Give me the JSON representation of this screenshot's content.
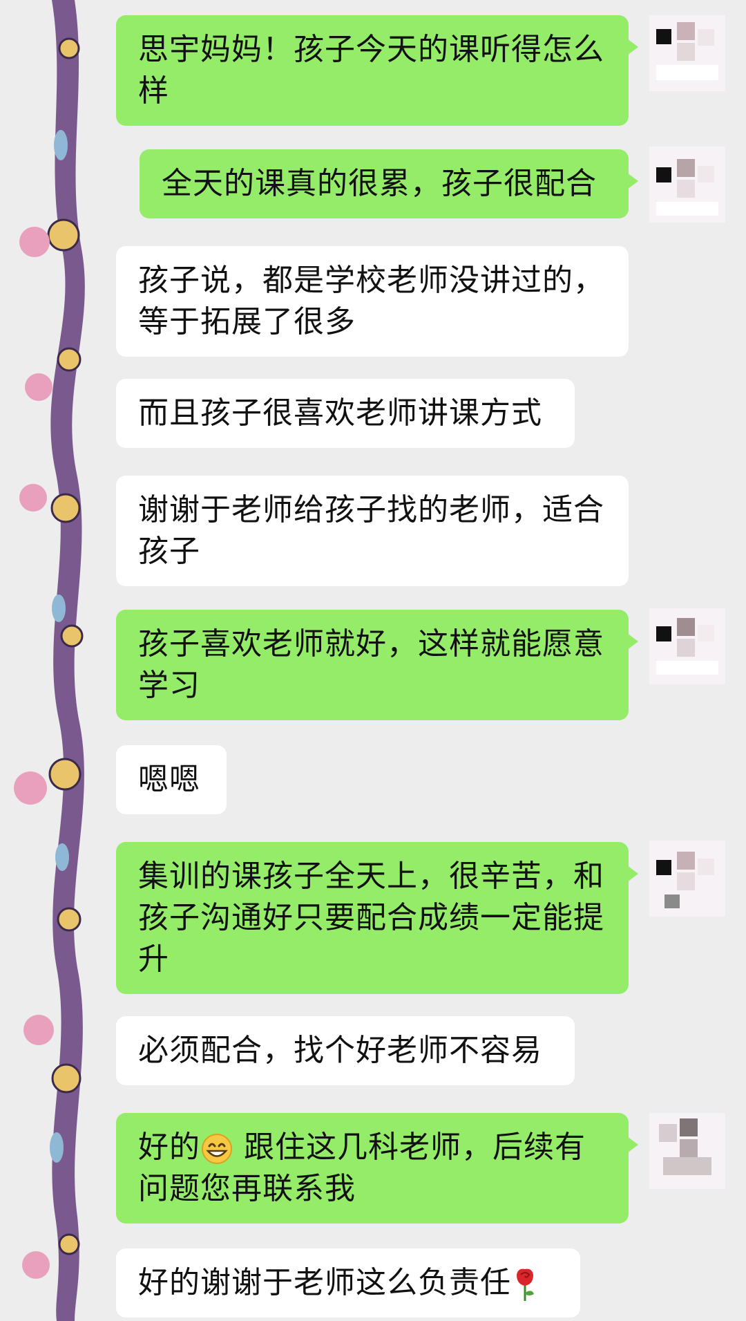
{
  "messages": [
    {
      "side": "out",
      "text": "思宇妈妈！孩子今天的课听得怎么样"
    },
    {
      "side": "out",
      "text": "全天的课真的很累，孩子很配合"
    },
    {
      "side": "in",
      "text": "孩子说，都是学校老师没讲过的，等于拓展了很多"
    },
    {
      "side": "in",
      "text": "而且孩子很喜欢老师讲课方式"
    },
    {
      "side": "in",
      "text": "谢谢于老师给孩子找的老师，适合孩子"
    },
    {
      "side": "out",
      "text": "孩子喜欢老师就好，这样就能愿意学习"
    },
    {
      "side": "in",
      "text": "嗯嗯"
    },
    {
      "side": "out",
      "text": "集训的课孩子全天上，很辛苦，和孩子沟通好只要配合成绩一定能提升"
    },
    {
      "side": "in",
      "text": "必须配合，找个好老师不容易"
    },
    {
      "side": "out",
      "text_before_emoji": "好的",
      "emoji": "grinning-face-emoji",
      "text_after_emoji": "跟住这几科老师，后续有问题您再联系我"
    },
    {
      "side": "in",
      "text": "好的谢谢于老师这么负责任",
      "emoji": "rose-emoji"
    }
  ],
  "colors": {
    "outgoing_bubble": "#95ec69",
    "incoming_bubble": "#ffffff",
    "background": "#ededed",
    "sticker_strip": "#7a5a8e"
  }
}
